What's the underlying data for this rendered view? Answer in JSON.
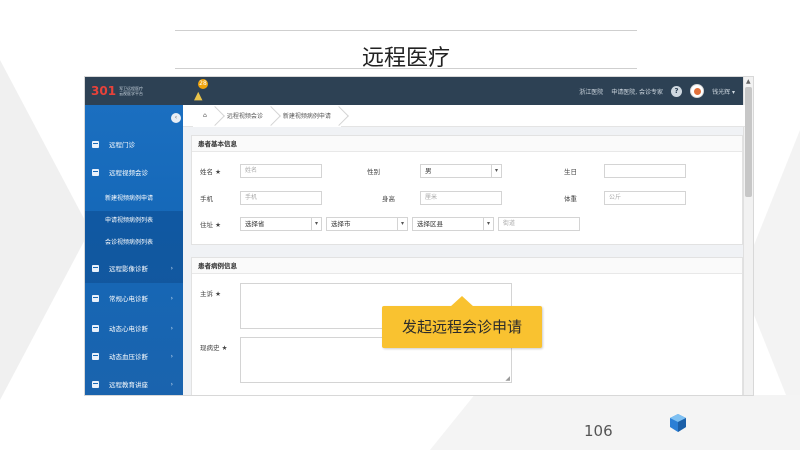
{
  "slide": {
    "title": "远程医疗",
    "page_number": "106"
  },
  "topbar": {
    "brand_number": "301",
    "brand_line1": "军卫远程医疗",
    "brand_line2": "云视医学平台",
    "notification_count": "28",
    "nav_items": [
      "浙江医院",
      "申请医院, 会诊专家"
    ],
    "user_name": "钱光辉"
  },
  "sidebar": {
    "items": [
      {
        "label": "远程门诊"
      },
      {
        "label": "远程视频会诊"
      },
      {
        "label": "远程影像诊断"
      },
      {
        "label": "常规心电诊断"
      },
      {
        "label": "动态心电诊断"
      },
      {
        "label": "动态血压诊断"
      },
      {
        "label": "远程教育讲座"
      }
    ],
    "sub_items": [
      {
        "label": "新建视频病例申请"
      },
      {
        "label": "申请视频病例列表"
      },
      {
        "label": "会诊视频病例列表"
      }
    ]
  },
  "breadcrumb": [
    "远程视频会诊",
    "新建视频病例申请"
  ],
  "basic_info": {
    "title": "患者基本信息",
    "name_label": "姓名 ★",
    "name_placeholder": "姓名",
    "gender_label": "性别",
    "gender_value": "男",
    "birthday_label": "生日",
    "phone_label": "手机",
    "phone_placeholder": "手机",
    "height_label": "身高",
    "height_placeholder": "厘米",
    "weight_label": "体重",
    "weight_placeholder": "公斤",
    "address_label": "住址 ★",
    "province_value": "选择省",
    "city_value": "选择市",
    "district_value": "选择区县",
    "street_placeholder": "街道"
  },
  "case_info": {
    "title": "患者病例信息",
    "complaint_label": "主诉 ★",
    "history_label": "现病史 ★"
  },
  "callout": {
    "text": "发起远程会诊申请"
  },
  "colors": {
    "topbar": "#2d4154",
    "sidebar": "#1568b8",
    "callout": "#f9c230",
    "brand_red": "#e8423a"
  }
}
